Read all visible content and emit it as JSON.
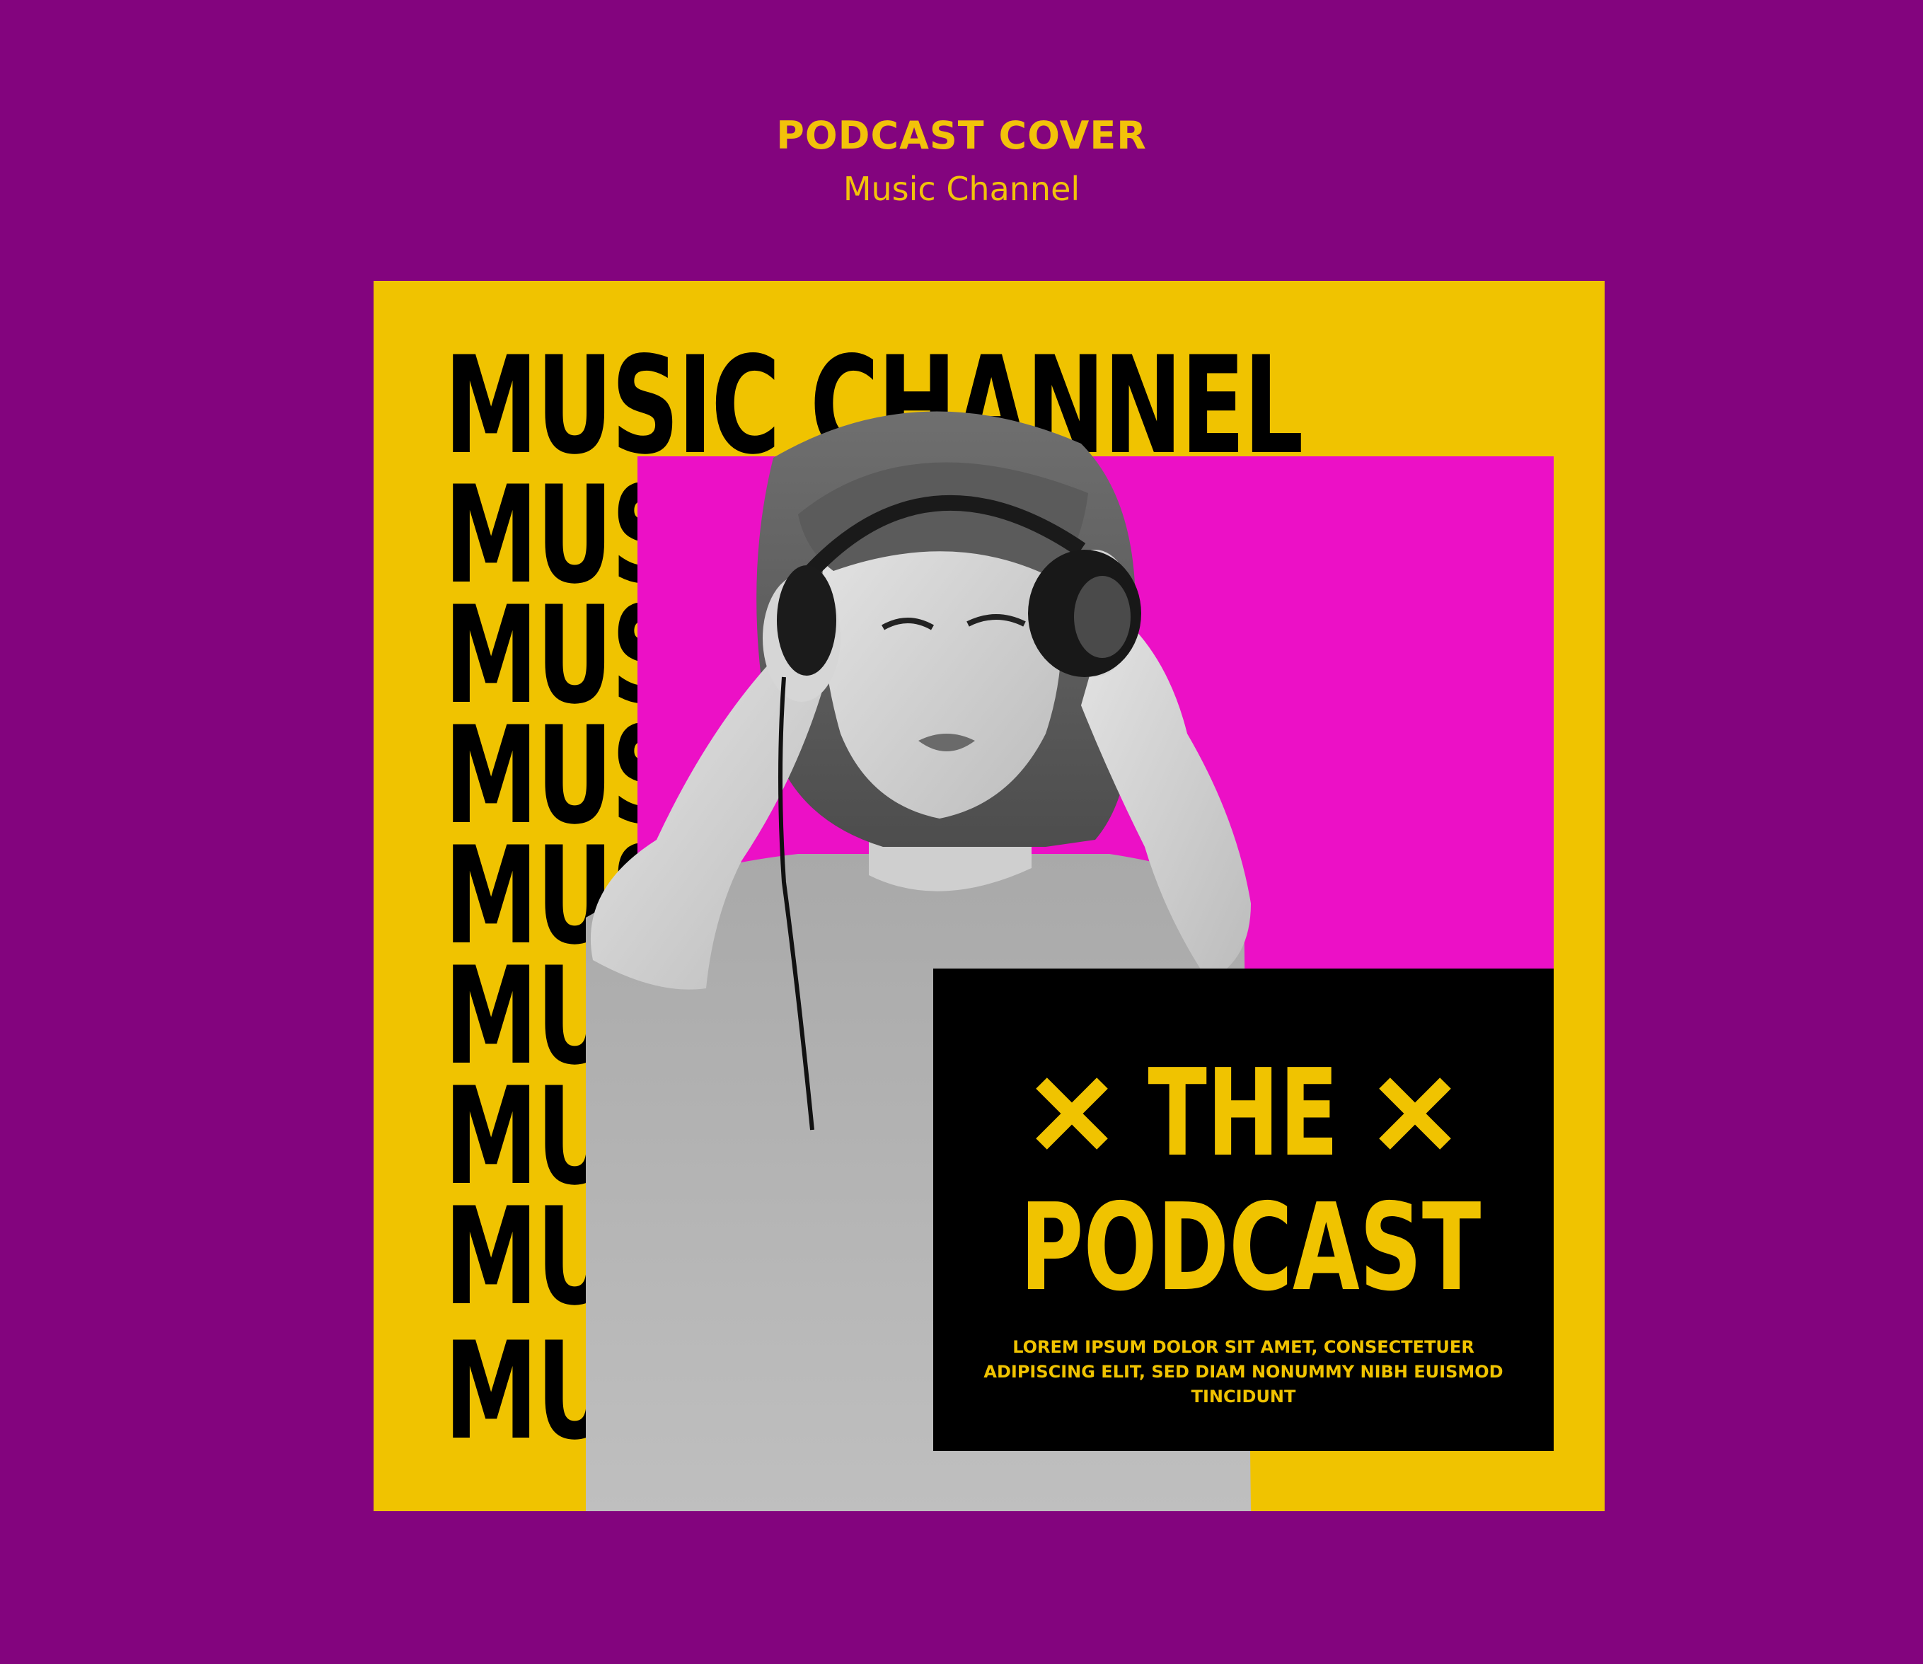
{
  "header": {
    "title": "PODCAST COVER",
    "subtitle": "Music Channel"
  },
  "cover": {
    "repeat_lines": [
      "MUSIC CHANNEL",
      "MUS",
      "MUS",
      "MUS",
      "MUS",
      "MUS",
      "MUS",
      "MUS",
      "MUSIC CHA"
    ],
    "podcast": {
      "the": "THE",
      "podcast": "PODCAST",
      "description": "LOREM IPSUM DOLOR SIT AMET, CONSECTETUER ADIPISCING ELIT, SED DIAM NONUMMY NIBH EUISMOD TINCIDUNT"
    }
  },
  "colors": {
    "background": "#83047e",
    "accent_yellow": "#f0c300",
    "accent_magenta": "#ec10c6",
    "black": "#000000"
  },
  "icons": [
    "x-icon-left",
    "x-icon-right"
  ]
}
